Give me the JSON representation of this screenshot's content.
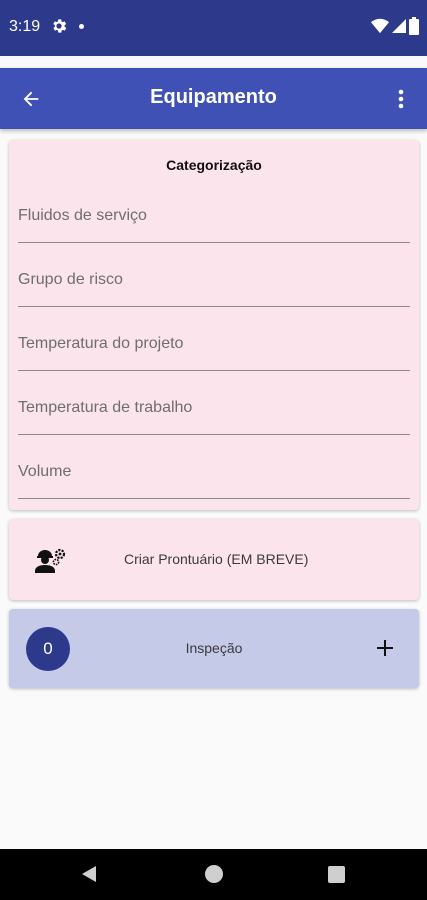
{
  "status_bar": {
    "time": "3:19",
    "icons": [
      "gear-icon",
      "notification-dot-icon",
      "wifi-icon",
      "signal-icon",
      "battery-icon"
    ]
  },
  "app_bar": {
    "title": "Equipamento",
    "back_icon": "arrow-back-icon",
    "menu_icon": "more-vert-icon",
    "color": "#3f51b5"
  },
  "categorizacao": {
    "title": "Categorização",
    "fields": [
      {
        "placeholder": "Fluidos de serviço"
      },
      {
        "placeholder": "Grupo de risco"
      },
      {
        "placeholder": "Temperatura do projeto"
      },
      {
        "placeholder": "Temperatura de trabalho"
      },
      {
        "placeholder": "Volume"
      }
    ],
    "background": "#fce4ec"
  },
  "prontuario": {
    "label": "Criar Prontuário (EM BREVE)",
    "icon": "engineer-gear-icon"
  },
  "inspecao": {
    "count": "0",
    "label": "Inspeção",
    "add_icon": "plus-icon",
    "background": "#c5cae9",
    "badge_color": "#2d3a8c"
  },
  "nav_bar": {
    "icons": [
      "nav-back-icon",
      "nav-home-icon",
      "nav-recents-icon"
    ]
  }
}
